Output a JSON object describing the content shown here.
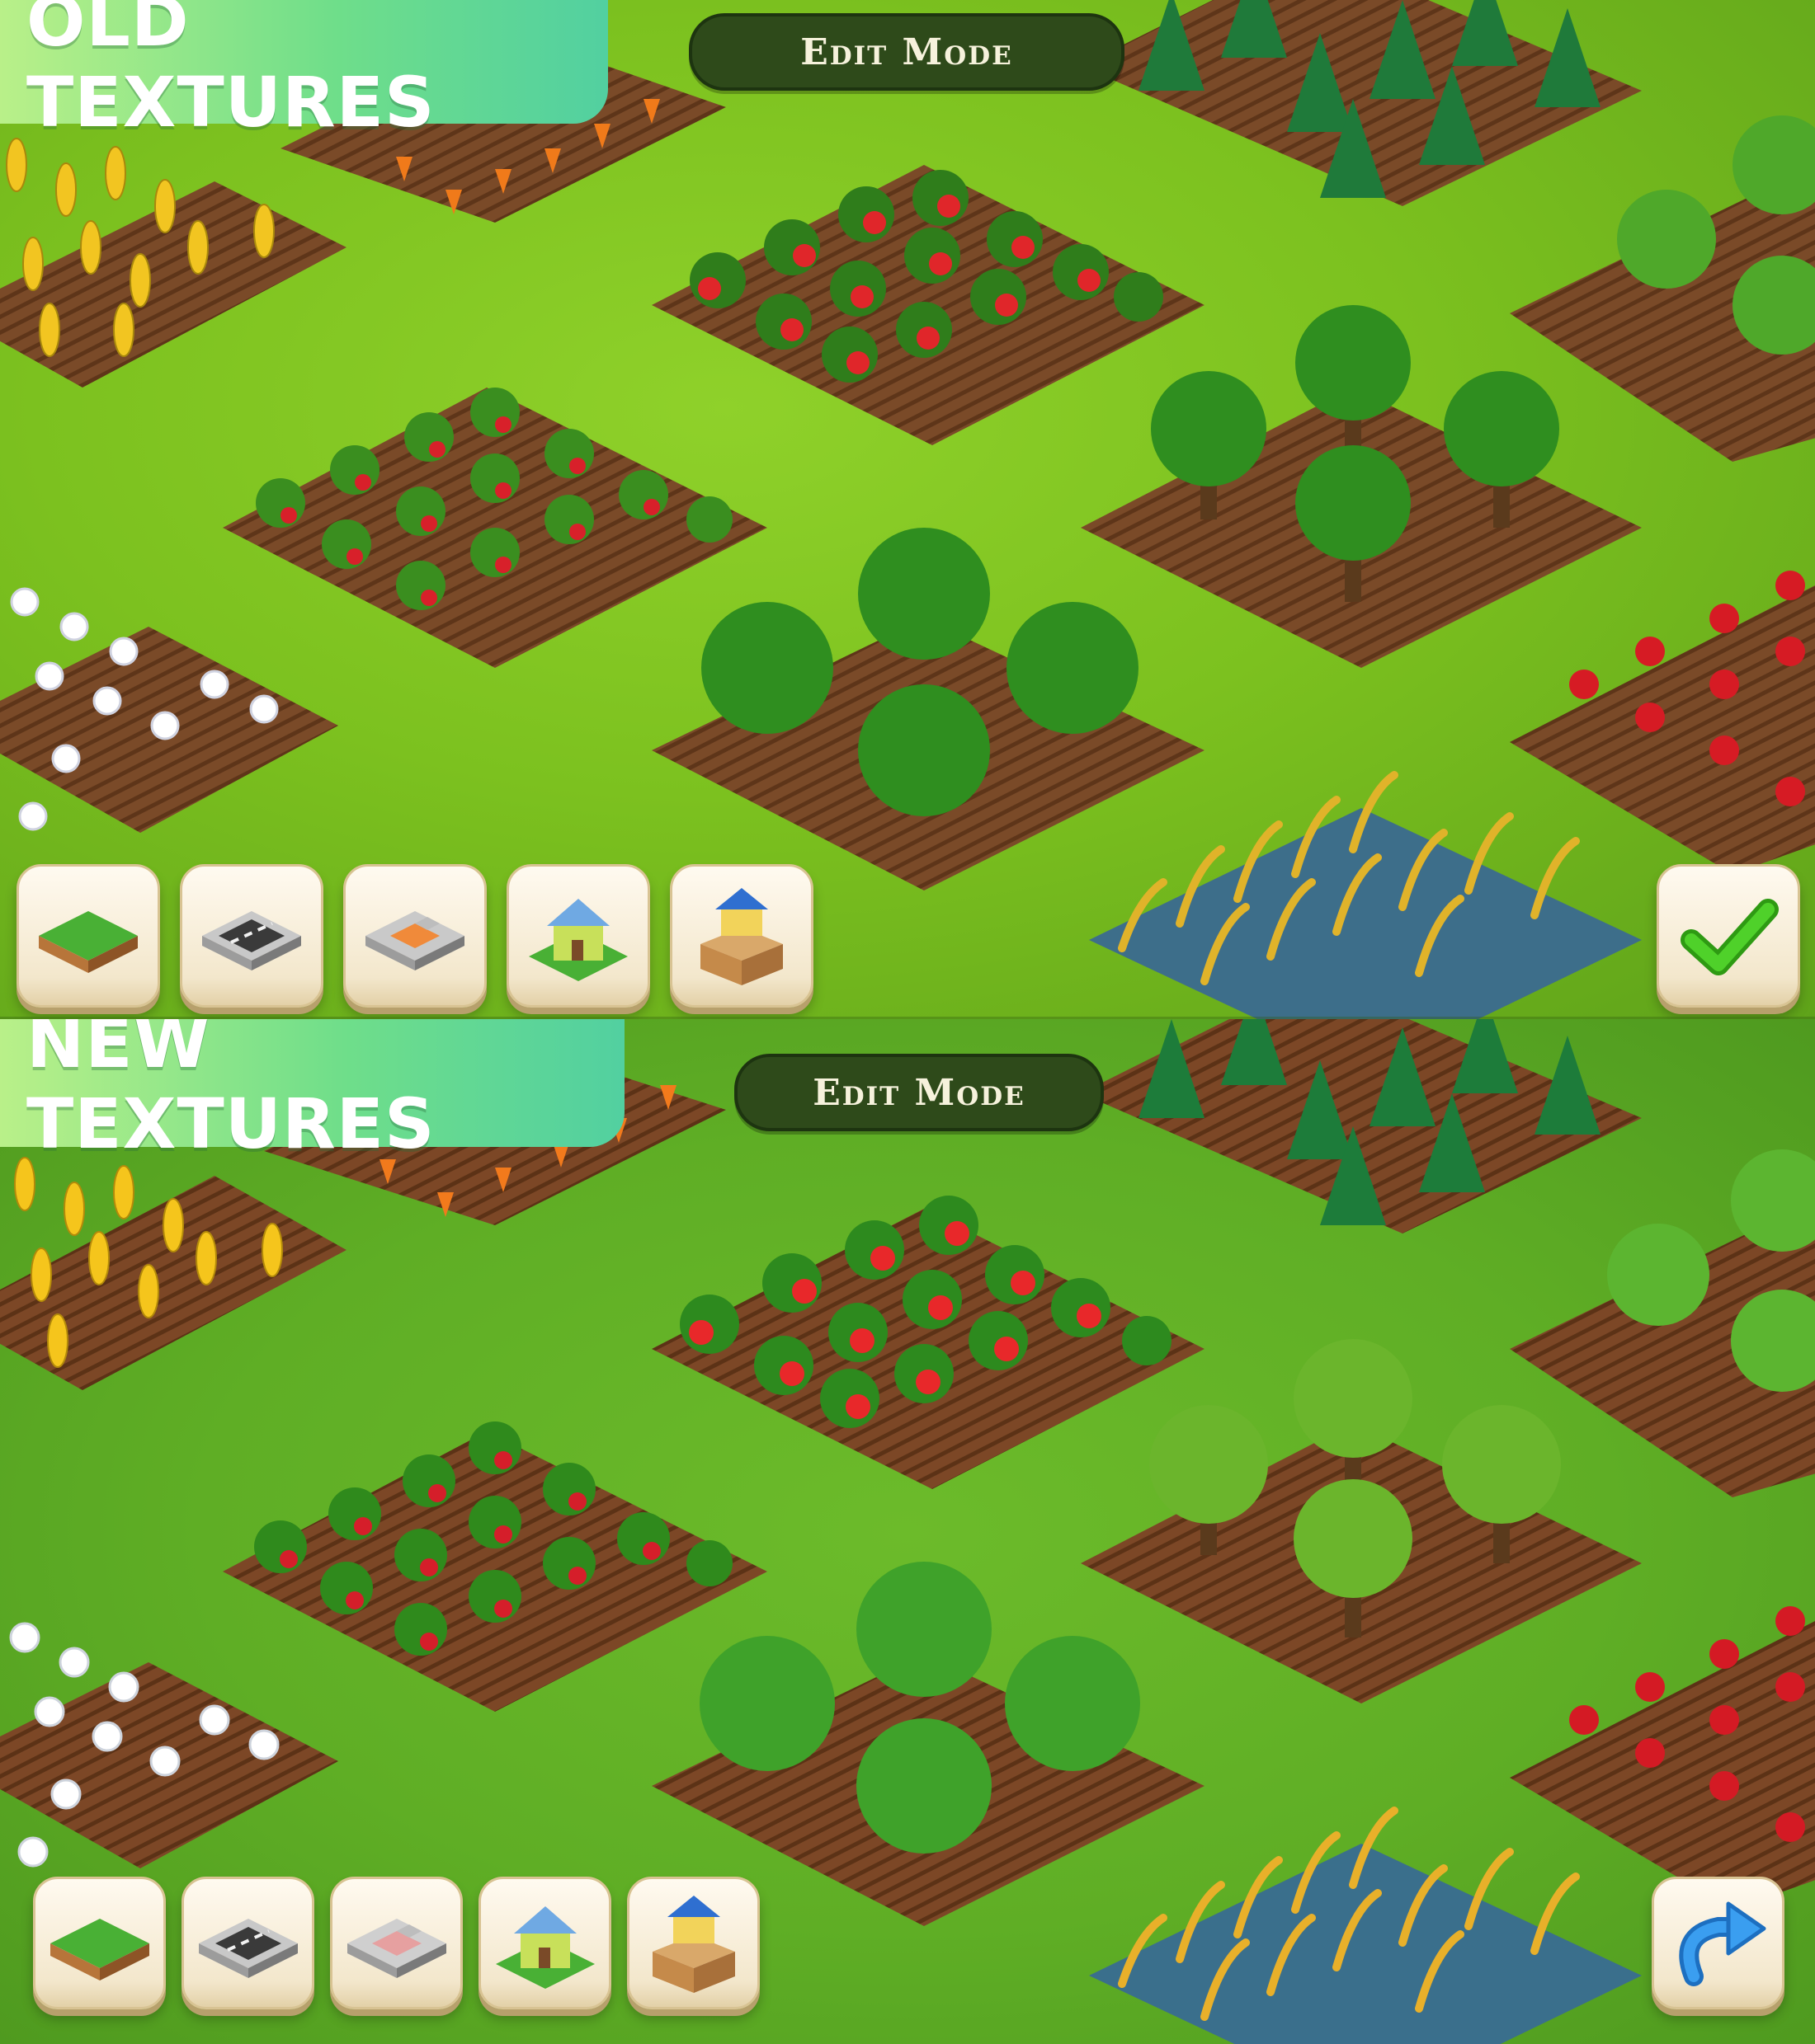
{
  "panels": [
    {
      "id": "old",
      "title": "OLD TEXTURES",
      "mode_label": "Edit Mode",
      "action": "confirm-check"
    },
    {
      "id": "new",
      "title": "NEW TEXTURES",
      "mode_label": "Edit Mode",
      "action": "redo-arrow"
    }
  ],
  "toolbar_icons": [
    "grass-tile-icon",
    "road-tile-icon",
    "floor-tile-icon",
    "decor-house-icon",
    "storage-box-icon"
  ],
  "colors": {
    "old_grass": "#7cc11f",
    "new_grass": "#5fae25",
    "soil": "#7a4a28",
    "banner_start": "#b9f089",
    "banner_end": "#52d0a0",
    "check_green": "#39c21a",
    "redo_blue": "#2f8fe0"
  }
}
